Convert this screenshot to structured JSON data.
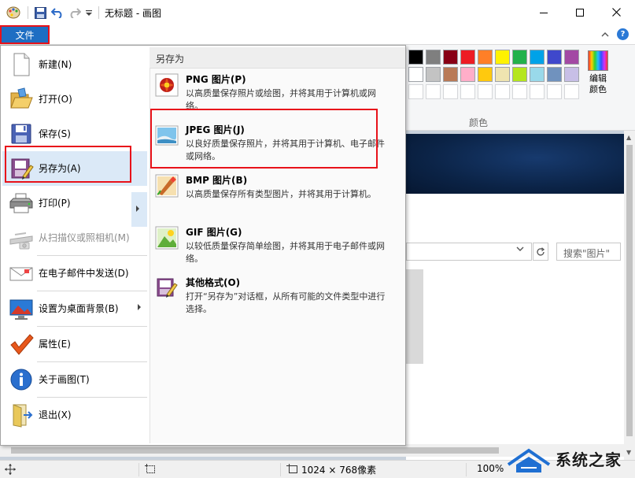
{
  "window": {
    "title": "无标题 - 画图"
  },
  "ribbon": {
    "file_tab": "文件",
    "colors_group_label": "颜色",
    "edit_colors_label_1": "编辑",
    "edit_colors_label_2": "颜色",
    "palette_row1": [
      "#000000",
      "#7f7f7f",
      "#880015",
      "#ed1c24",
      "#ff7f27",
      "#fff200",
      "#22b14c",
      "#00a2e8",
      "#3f48cc",
      "#a349a4"
    ],
    "palette_row2": [
      "#ffffff",
      "#c3c3c3",
      "#b97a57",
      "#ffaec9",
      "#ffc90e",
      "#efe4b0",
      "#b5e61d",
      "#99d9ea",
      "#7092be",
      "#c8bfe7"
    ]
  },
  "file_menu": {
    "items": [
      {
        "label": "新建(N)",
        "icon": "new-file-icon"
      },
      {
        "label": "打开(O)",
        "icon": "open-folder-icon"
      },
      {
        "label": "保存(S)",
        "icon": "save-icon"
      },
      {
        "label": "另存为(A)",
        "icon": "save-as-icon"
      },
      {
        "label": "打印(P)",
        "icon": "printer-icon"
      },
      {
        "label": "从扫描仪或照相机(M)",
        "icon": "scanner-icon"
      },
      {
        "label": "在电子邮件中发送(D)",
        "icon": "email-icon"
      },
      {
        "label": "设置为桌面背景(B)",
        "icon": "desktop-background-icon"
      },
      {
        "label": "属性(E)",
        "icon": "checkmark-icon"
      },
      {
        "label": "关于画图(T)",
        "icon": "info-icon"
      },
      {
        "label": "退出(X)",
        "icon": "exit-icon"
      }
    ]
  },
  "save_as_submenu": {
    "header": "另存为",
    "items": [
      {
        "title": "PNG 图片(P)",
        "desc": "以高质量保存照片或绘图，并将其用于计算机或网络。"
      },
      {
        "title": "JPEG 图片(J)",
        "desc": "以良好质量保存照片，并将其用于计算机、电子邮件或网络。"
      },
      {
        "title": "BMP 图片(B)",
        "desc": "以高质量保存所有类型图片，并将其用于计算机。"
      },
      {
        "title": "GIF 图片(G)",
        "desc": "以较低质量保存简单绘图，并将其用于电子邮件或网络。"
      },
      {
        "title": "其他格式(O)",
        "desc": "打开“另存为”对话框，从所有可能的文件类型中进行选择。"
      }
    ]
  },
  "explorer": {
    "search_placeholder": "搜索\"图片\""
  },
  "statusbar": {
    "canvas_size": "1024 × 768像素",
    "zoom": "100%"
  },
  "watermark": {
    "text": "系统之家"
  }
}
